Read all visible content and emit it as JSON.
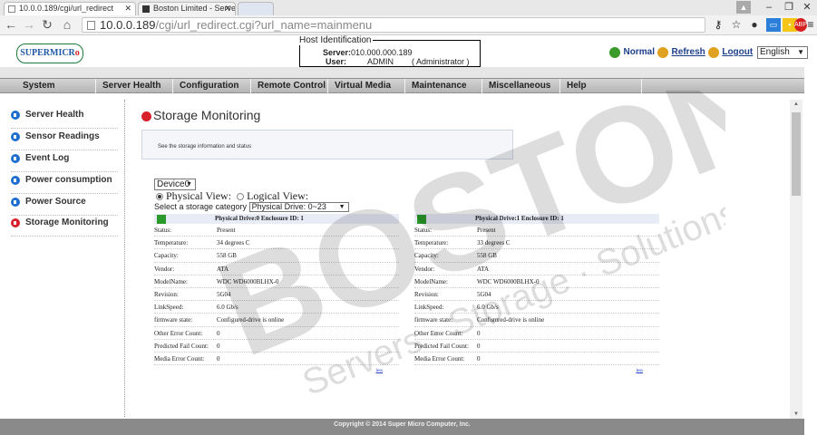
{
  "browser": {
    "tabs": [
      {
        "title": "10.0.0.189/cgi/url_redirect"
      },
      {
        "title": "Boston Limited - Server, S"
      }
    ],
    "url_host": "10.0.0.189",
    "url_path": "/cgi/url_redirect.cgi?url_name=mainmenu"
  },
  "host": {
    "legend": "Host Identification",
    "server_label": "Server:",
    "server_value": "010.000.000.189",
    "user_label": "User:",
    "user_value": "ADMIN",
    "user_role": "( Administrator )"
  },
  "logo": {
    "text": "SUPERMICR",
    "dot": "o"
  },
  "status": {
    "normal": "Normal",
    "refresh": "Refresh",
    "logout": "Logout",
    "language": "English"
  },
  "menu": [
    "System",
    "Server Health",
    "Configuration",
    "Remote Control",
    "Virtual Media",
    "Maintenance",
    "Miscellaneous",
    "Help"
  ],
  "sidebar": [
    {
      "label": "Server Health"
    },
    {
      "label": "Sensor Readings"
    },
    {
      "label": "Event Log"
    },
    {
      "label": "Power consumption"
    },
    {
      "label": "Power Source"
    },
    {
      "label": "Storage Monitoring"
    }
  ],
  "main": {
    "title": "Storage Monitoring",
    "info": "See the storage information and status",
    "device": "Device0",
    "physical_view": "Physical View:",
    "logical_view": "Logical View:",
    "category_label": "Select a storage category",
    "category_value": "Physical Drive: 0~23",
    "less": "less"
  },
  "drives": [
    {
      "header": "Physical Drive:0 Enclosure ID: 1",
      "rows": [
        {
          "k": "Status:",
          "v": "Present"
        },
        {
          "k": "Temperature:",
          "v": "34 degrees C"
        },
        {
          "k": "Capacity:",
          "v": "558 GB"
        },
        {
          "k": "Vendor:",
          "v": "ATA"
        },
        {
          "k": "ModelName:",
          "v": "WDC WD6000BLHX-0"
        },
        {
          "k": "Revision:",
          "v": "5G04"
        },
        {
          "k": "LinkSpeed:",
          "v": "6.0 Gb/s"
        },
        {
          "k": "firmware state:",
          "v": "Configured-drive is online"
        },
        {
          "k": "Other Error Count:",
          "v": "0"
        },
        {
          "k": "Predicted Fail Count:",
          "v": "0"
        },
        {
          "k": "Media Error Count:",
          "v": "0"
        }
      ]
    },
    {
      "header": "Physical Drive:1 Enclosure ID: 1",
      "rows": [
        {
          "k": "Status:",
          "v": "Present"
        },
        {
          "k": "Temperature:",
          "v": "33 degrees C"
        },
        {
          "k": "Capacity:",
          "v": "558 GB"
        },
        {
          "k": "Vendor:",
          "v": "ATA"
        },
        {
          "k": "ModelName:",
          "v": "WDC WD6000BLHX-0"
        },
        {
          "k": "Revision:",
          "v": "5G04"
        },
        {
          "k": "LinkSpeed:",
          "v": "6.0 Gb/s"
        },
        {
          "k": "firmware state:",
          "v": "Configured-drive is online"
        },
        {
          "k": "Other Error Count:",
          "v": "0"
        },
        {
          "k": "Predicted Fail Count:",
          "v": "0"
        },
        {
          "k": "Media Error Count:",
          "v": "0"
        }
      ]
    }
  ],
  "watermark": {
    "brand": "BOSTON",
    "tagline": "Servers · Storage · Solutions"
  },
  "footer": "Copyright © 2014 Super Micro Computer, Inc.",
  "colors": {
    "accent_blue": "#1f6fcf",
    "accent_red": "#d8202a",
    "status_green": "#2a9a2a"
  }
}
